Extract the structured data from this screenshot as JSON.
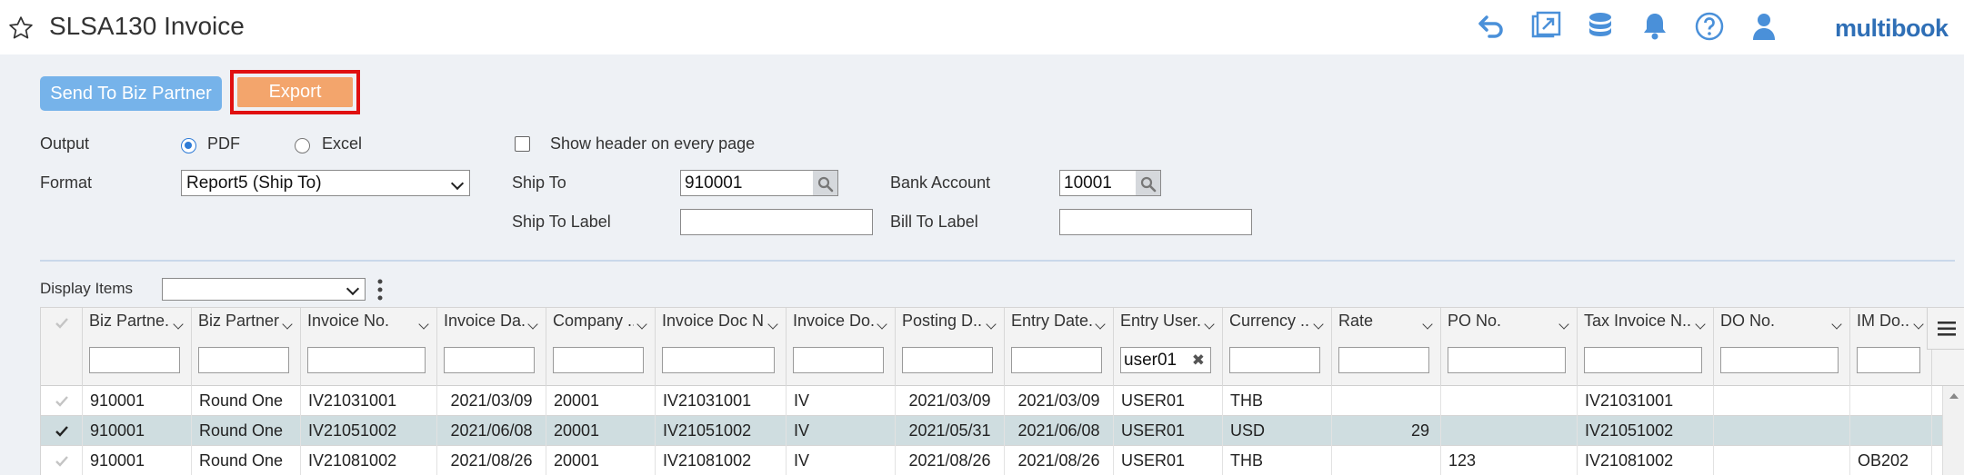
{
  "header": {
    "title": "SLSA130 Invoice",
    "logo": "multibook",
    "icons": [
      "star-icon",
      "undo-icon",
      "popout-icon",
      "database-icon",
      "bell-icon",
      "help-icon",
      "user-icon"
    ],
    "accent": "#4a90d9"
  },
  "actions": {
    "send_label": "Send To Biz Partner",
    "export_label": "Export"
  },
  "form": {
    "output_label": "Output",
    "pdf_label": "PDF",
    "excel_label": "Excel",
    "output_selected": "PDF",
    "show_header_label": "Show header on every page",
    "show_header_checked": false,
    "format_label": "Format",
    "format_value": "Report5 (Ship To)",
    "ship_to_label": "Ship To",
    "ship_to_value": "910001",
    "ship_to_label_label": "Ship To Label",
    "ship_to_label_value": "",
    "bank_account_label": "Bank Account",
    "bank_account_value": "10001",
    "bill_to_label_label": "Bill To Label",
    "bill_to_label_value": ""
  },
  "display": {
    "label": "Display Items",
    "value": ""
  },
  "grid": {
    "columns": [
      {
        "label": "Biz Partne..",
        "filter": ""
      },
      {
        "label": "Biz Partner N..",
        "filter": ""
      },
      {
        "label": "Invoice No.",
        "filter": ""
      },
      {
        "label": "Invoice Da..",
        "filter": ""
      },
      {
        "label": "Company ..",
        "filter": ""
      },
      {
        "label": "Invoice Doc N..",
        "filter": ""
      },
      {
        "label": "Invoice Do..",
        "filter": ""
      },
      {
        "label": "Posting D..",
        "filter": ""
      },
      {
        "label": "Entry Date..",
        "filter": ""
      },
      {
        "label": "Entry User..",
        "filter": "user01"
      },
      {
        "label": "Currency ..",
        "filter": ""
      },
      {
        "label": "Rate",
        "filter": ""
      },
      {
        "label": "PO No.",
        "filter": ""
      },
      {
        "label": "Tax Invoice N..",
        "filter": ""
      },
      {
        "label": "DO No.",
        "filter": ""
      },
      {
        "label": "IM Do..",
        "filter": ""
      }
    ],
    "rows": [
      {
        "selected": false,
        "cells": [
          "910001",
          "Round One",
          "IV21031001",
          "2021/03/09",
          "20001",
          "IV21031001",
          "IV",
          "2021/03/09",
          "2021/03/09",
          "USER01",
          "THB",
          "",
          "",
          "IV21031001",
          "",
          ""
        ]
      },
      {
        "selected": true,
        "cells": [
          "910001",
          "Round One",
          "IV21051002",
          "2021/06/08",
          "20001",
          "IV21051002",
          "IV",
          "2021/05/31",
          "2021/06/08",
          "USER01",
          "USD",
          "29",
          "",
          "IV21051002",
          "",
          ""
        ]
      },
      {
        "selected": false,
        "cells": [
          "910001",
          "Round One",
          "IV21081002",
          "2021/08/26",
          "20001",
          "IV21081002",
          "IV",
          "2021/08/26",
          "2021/08/26",
          "USER01",
          "THB",
          "",
          "123",
          "IV21081002",
          "",
          "OB202"
        ]
      }
    ]
  }
}
